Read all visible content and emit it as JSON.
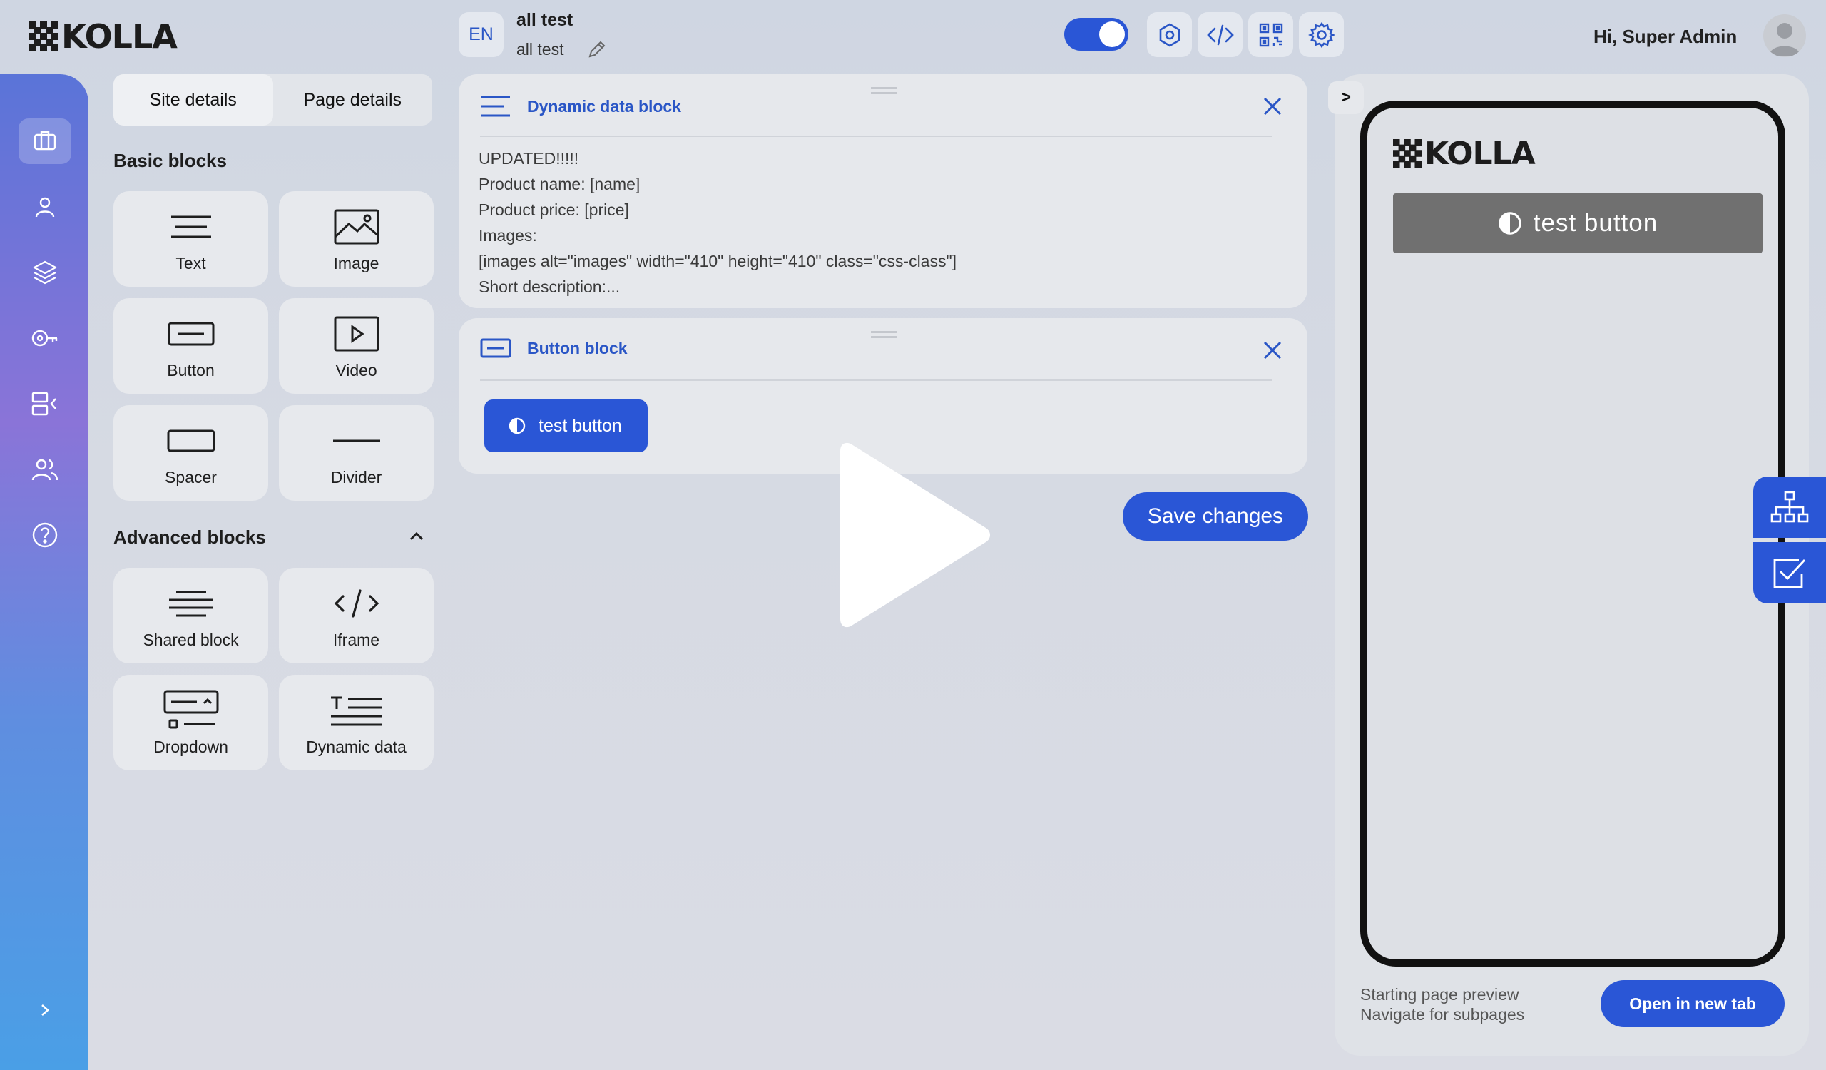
{
  "brand": {
    "logo_text": "KOLLA"
  },
  "topbar": {
    "language": "EN",
    "page_title": "all test",
    "page_subtitle": "all test",
    "greeting": "Hi, Super Admin",
    "accent": "#2a56d6"
  },
  "sidenav": {
    "items": [
      "sites-icon",
      "user-icon",
      "layers-icon",
      "key-icon",
      "content-icon",
      "users-icon",
      "help-icon"
    ],
    "expand_symbol": "›"
  },
  "blocks_panel": {
    "tabs": [
      "Site details",
      "Page details"
    ],
    "basic_title": "Basic blocks",
    "basic_blocks": [
      "Text",
      "Image",
      "Button",
      "Video",
      "Spacer",
      "Divider"
    ],
    "advanced_title": "Advanced blocks",
    "advanced_blocks": [
      "Shared block",
      "Iframe",
      "Dropdown",
      "Dynamic data"
    ]
  },
  "editor": {
    "dynamic_card": {
      "title": "Dynamic data block",
      "lines": [
        "UPDATED!!!!!",
        "Product name: [name]",
        "Product price: [price]",
        "Images:",
        "[images alt=\"images\" width=\"410\" height=\"410\" class=\"css-class\"]",
        "Short description:..."
      ]
    },
    "button_card": {
      "title": "Button block",
      "button_label": "test button"
    },
    "save_label": "Save changes"
  },
  "preview": {
    "expand_label": ">",
    "logo_text": "KOLLA",
    "button_label": "test button",
    "note_line1": "Starting page preview",
    "note_line2": "Navigate for subpages",
    "open_tab_label": "Open in new tab"
  }
}
